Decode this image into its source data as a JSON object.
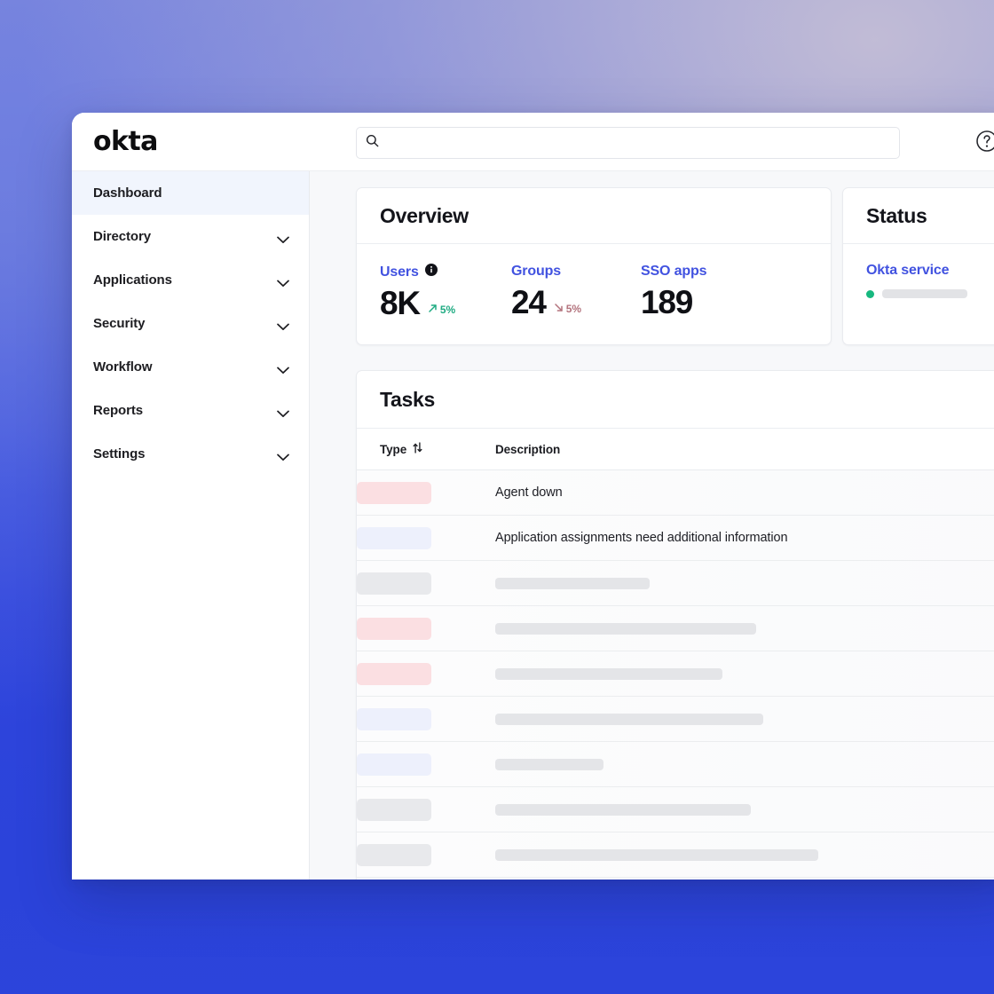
{
  "app": {
    "logo_text": "okta",
    "help_icon": "question-circle-icon"
  },
  "search": {
    "value": "",
    "placeholder": "",
    "icon": "search-icon"
  },
  "sidebar": {
    "items": [
      {
        "label": "Dashboard",
        "active": true,
        "expandable": false
      },
      {
        "label": "Directory",
        "active": false,
        "expandable": true
      },
      {
        "label": "Applications",
        "active": false,
        "expandable": true
      },
      {
        "label": "Security",
        "active": false,
        "expandable": true
      },
      {
        "label": "Workflow",
        "active": false,
        "expandable": true
      },
      {
        "label": "Reports",
        "active": false,
        "expandable": true
      },
      {
        "label": "Settings",
        "active": false,
        "expandable": true
      }
    ]
  },
  "overview": {
    "title": "Overview",
    "metrics": [
      {
        "label": "Users",
        "value": "8K",
        "has_info_icon": true,
        "delta": "5%",
        "delta_direction": "up",
        "delta_color": "#1fab82"
      },
      {
        "label": "Groups",
        "value": "24",
        "has_info_icon": false,
        "delta": "5%",
        "delta_direction": "down",
        "delta_color": "#b3737d"
      },
      {
        "label": "SSO apps",
        "value": "189",
        "has_info_icon": false,
        "delta": null,
        "delta_direction": null,
        "delta_color": null
      }
    ]
  },
  "status": {
    "title": "Status",
    "service_label": "Okta service",
    "indicator_color": "#17b87f"
  },
  "tasks": {
    "title": "Tasks",
    "columns": [
      {
        "label": "Type",
        "sortable": true,
        "sort_icon": "sort-arrows-icon"
      },
      {
        "label": "Description",
        "sortable": false
      }
    ],
    "rows": [
      {
        "badge_color": "red",
        "badge_width": 84,
        "description": "Agent down",
        "desc_skeleton_width": 0
      },
      {
        "badge_color": "blue",
        "badge_width": 84,
        "description": "Application assignments need additional information",
        "desc_skeleton_width": 0
      },
      {
        "badge_color": "gray",
        "badge_width": 84,
        "description": "",
        "desc_skeleton_width": 174
      },
      {
        "badge_color": "red",
        "badge_width": 84,
        "description": "",
        "desc_skeleton_width": 294
      },
      {
        "badge_color": "red",
        "badge_width": 84,
        "description": "",
        "desc_skeleton_width": 256
      },
      {
        "badge_color": "blue",
        "badge_width": 84,
        "description": "",
        "desc_skeleton_width": 302
      },
      {
        "badge_color": "blue",
        "badge_width": 84,
        "description": "",
        "desc_skeleton_width": 122
      },
      {
        "badge_color": "gray",
        "badge_width": 84,
        "description": "",
        "desc_skeleton_width": 288
      },
      {
        "badge_color": "gray",
        "badge_width": 84,
        "description": "",
        "desc_skeleton_width": 364
      },
      {
        "badge_color": "blue",
        "badge_width": 84,
        "description": "",
        "desc_skeleton_width": 122
      }
    ]
  },
  "theme": {
    "link_blue": "#4152e0",
    "active_nav_bg": "#f1f5fd",
    "badge_red": "#fbdfe2",
    "badge_blue": "#edf0fc",
    "badge_gray": "#e8e9ec",
    "page_bg": "#f7f8fa"
  }
}
